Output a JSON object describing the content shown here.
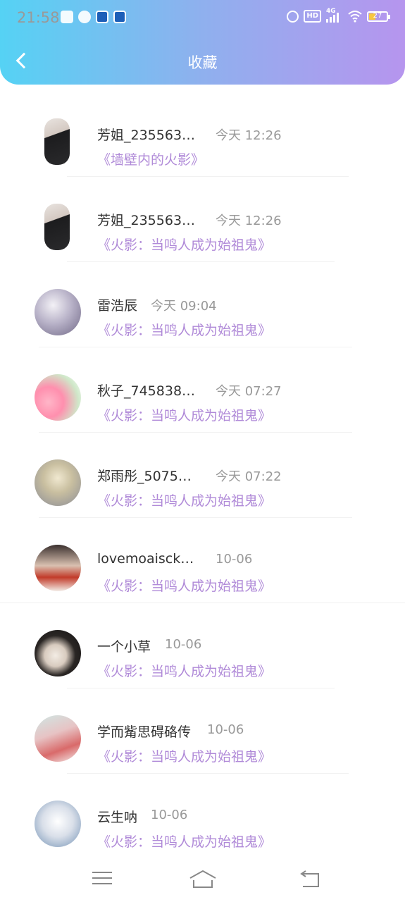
{
  "status_bar": {
    "time": "21:58",
    "network": "4G",
    "battery": "27"
  },
  "header": {
    "title": "收藏"
  },
  "items": [
    {
      "name": "芳姐_235563…",
      "time": "今天 12:26",
      "post": "《墙壁内的火影》"
    },
    {
      "name": "芳姐_235563…",
      "time": "今天 12:26",
      "post": "《火影：当鸣人成为始祖鬼》"
    },
    {
      "name": "雷浩辰",
      "time": "今天 09:04",
      "post": "《火影：当鸣人成为始祖鬼》"
    },
    {
      "name": "秋子_745838…",
      "time": "今天 07:27",
      "post": "《火影：当鸣人成为始祖鬼》"
    },
    {
      "name": "郑雨彤_5075…",
      "time": "今天 07:22",
      "post": "《火影：当鸣人成为始祖鬼》"
    },
    {
      "name": "lovemoaisck…",
      "time": "10-06",
      "post": "《火影：当鸣人成为始祖鬼》"
    },
    {
      "name": "一个小草",
      "time": "10-06",
      "post": "《火影：当鸣人成为始祖鬼》"
    },
    {
      "name": "学而觜思碍硌传",
      "time": "10-06",
      "post": "《火影：当鸣人成为始祖鬼》"
    },
    {
      "name": "云生呐",
      "time": "10-06",
      "post": "《火影：当鸣人成为始祖鬼》"
    }
  ],
  "colors": {
    "accent_text": "#b08ad8",
    "header_start": "#55d2f4",
    "header_end": "#b695ee"
  },
  "icons": [
    "back-icon",
    "menu-icon",
    "home-icon",
    "return-icon"
  ]
}
